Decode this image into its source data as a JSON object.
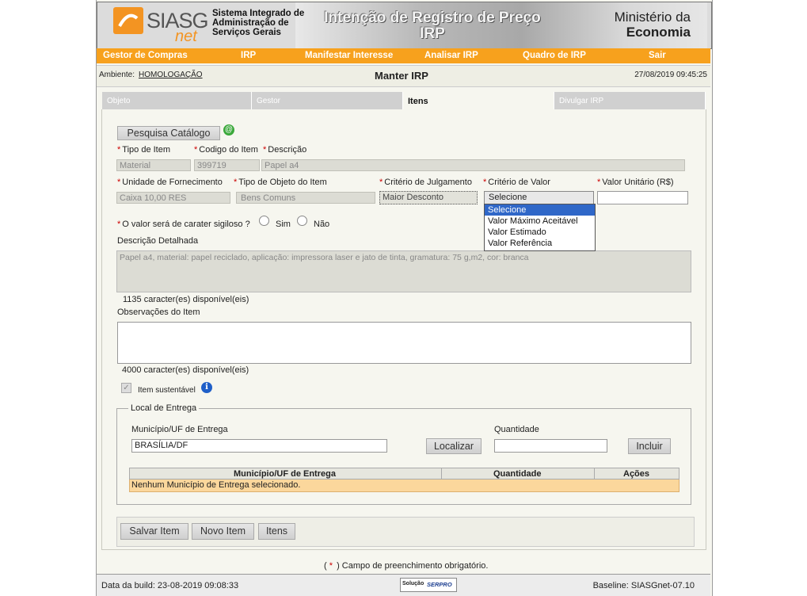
{
  "header": {
    "logo_siasg": "SIASG",
    "logo_net": "net",
    "system_name": [
      "Sistema Integrado de",
      "Administração de",
      "Serviços Gerais"
    ],
    "banner_title": [
      "Intenção de Registro de Preço",
      "IRP"
    ],
    "ministry_line1": "Ministério da",
    "ministry_line2": "Economia"
  },
  "menu": {
    "items": [
      "Gestor de Compras",
      "IRP",
      "Manifestar Interesse",
      "Analisar IRP",
      "Quadro de IRP",
      "Sair"
    ]
  },
  "env_bar": {
    "env_label": "Ambiente:",
    "env_value": "HOMOLOGAÇÃO",
    "page_title": "Manter IRP",
    "datetime": "27/08/2019 09:45:25"
  },
  "tabs": [
    "Objeto",
    "Gestor",
    "Itens",
    "Divulgar IRP"
  ],
  "form": {
    "catalog_button": "Pesquisa Catálogo",
    "tipo_item_label": "Tipo de Item",
    "codigo_item_label": "Codigo do Item",
    "descricao_label": "Descrição",
    "tipo_item_value": "Material",
    "codigo_item_value": "399719",
    "descricao_value": "Papel a4",
    "unidade_label": "Unidade de Fornecimento",
    "tipo_objeto_label": "Tipo de Objeto do Item",
    "criterio_julgamento_label": "Critério de Julgamento",
    "criterio_valor_label": "Critério de Valor",
    "valor_unitario_label": "Valor Unitário (R$)",
    "unidade_value": "Caixa 10,00 RES",
    "tipo_objeto_value": "Bens Comuns",
    "criterio_julgamento_value": "Maior Desconto",
    "criterio_valor_value": "Selecione",
    "valor_unitario_value": "",
    "criterio_valor_options": [
      "Selecione",
      "Valor Máximo Aceitável",
      "Valor Estimado",
      "Valor Referência"
    ],
    "sigiloso_label": "O valor será de carater sigiloso ?",
    "sim_label": "Sim",
    "nao_label": "Não",
    "descricao_detalhada_label": "Descrição Detalhada",
    "descricao_detalhada_value": "Papel a4, material: papel reciclado, aplicação: impressora laser e jato de tinta, gramatura: 75 g,m2, cor: branca",
    "descricao_chars": "1135 caracter(es) disponível(eis)",
    "observacoes_label": "Observações do Item",
    "observacoes_value": "",
    "observacoes_chars": "4000 caracter(es) disponível(eis)",
    "sustentavel_label": "Item sustentável"
  },
  "local_entrega": {
    "legend": "Local de Entrega",
    "municipio_label": "Município/UF de Entrega",
    "municipio_value": "BRASÍLIA/DF",
    "localizar_button": "Localizar",
    "quantidade_label": "Quantidade",
    "quantidade_value": "",
    "incluir_button": "Incluir",
    "table_headers": [
      "Município/UF de Entrega",
      "Quantidade",
      "Ações"
    ],
    "empty_message": "Nenhum Município de Entrega selecionado."
  },
  "actions": [
    "Salvar Item",
    "Novo Item",
    "Itens"
  ],
  "required_note": "Campo de preenchimento obrigatório.",
  "footer": {
    "build": "Data da build: 23-08-2019 09:08:33",
    "solucao": "Solução",
    "serpro": "SERPRO",
    "baseline": "Baseline: SIASGnet-07.10"
  },
  "colors": {
    "menu_orange": "#f7a11d",
    "logo_orange": "#f39422",
    "row_highlight": "#fbd79c",
    "dropdown_select": "#2f67c8"
  }
}
